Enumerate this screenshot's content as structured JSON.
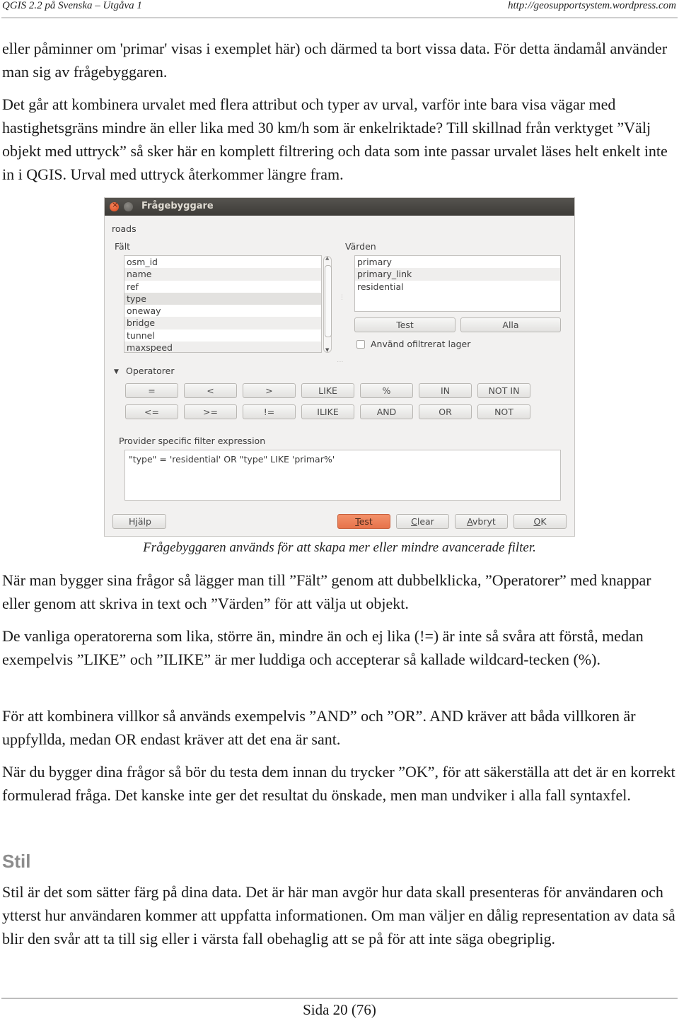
{
  "header": {
    "left": "QGIS 2.2 på Svenska – Utgåva 1",
    "right": "http://geosupportsystem.wordpress.com"
  },
  "paragraphs": {
    "p1": "eller påminner om 'primar' visas i exemplet här) och därmed ta bort vissa data. För detta ändamål använder man sig av frågebyggaren.",
    "p2": "Det går att kombinera urvalet med flera attribut och typer av urval, varför inte bara visa vägar med hastighetsgräns mindre än eller lika med 30 km/h som är enkelriktade? Till skillnad från verktyget ”Välj objekt med uttryck” så sker här en komplett filtrering och data som inte passar urvalet läses helt enkelt inte in i QGIS. Urval med uttryck återkommer längre fram.",
    "p3": "När man bygger sina frågor så lägger man till ”Fält” genom att dubbelklicka, ”Operatorer” med knappar eller genom att skriva in text och ”Värden” för att välja ut objekt.",
    "p4": "De vanliga operatorerna som lika, större än, mindre än och ej lika (!=) är inte så svåra att förstå, medan exempelvis ”LIKE” och ”ILIKE” är mer luddiga och accepterar så kallade wildcard-tecken (%).",
    "p5": "För att kombinera villkor så används exempelvis ”AND” och ”OR”. AND kräver att båda villkoren är uppfyllda, medan OR endast kräver att det ena är sant.",
    "p6": "När du bygger dina frågor så bör du testa dem innan du trycker ”OK”, för att säkerställa att det är en korrekt formulerad fråga. Det kanske inte ger det resultat du önskade, men man undviker i alla fall syntaxfel.",
    "p7": "Stil är det som sätter färg på dina data. Det är här man avgör hur data skall presenteras för användaren och ytterst hur användaren kommer att uppfatta informationen. Om man väljer en dålig representation av data så blir den svår att ta till sig eller i värsta fall obehaglig att se på för att inte säga obegriplig."
  },
  "heading_stil": "Stil",
  "caption": "Frågebyggaren används för att skapa mer eller mindre avancerade filter.",
  "footer": "Sida 20 (76)",
  "dialog": {
    "title": "Frågebyggare",
    "layer_name": "roads",
    "fields_label": "Fält",
    "fields": [
      "osm_id",
      "name",
      "ref",
      "type",
      "oneway",
      "bridge",
      "tunnel",
      "maxspeed"
    ],
    "selected_field": "type",
    "values_label": "Värden",
    "values": [
      "primary",
      "primary_link",
      "residential"
    ],
    "test_values_button": "Test",
    "all_values_button": "Alla",
    "unfiltered_checkbox_label": "Använd ofiltrerat lager",
    "unfiltered_checked": false,
    "operators_label": "Operatorer",
    "operators_row1": [
      "=",
      "<",
      ">",
      "LIKE",
      "%",
      "IN",
      "NOT IN"
    ],
    "operators_row2": [
      "<=",
      ">=",
      "!=",
      "ILIKE",
      "AND",
      "OR",
      "NOT"
    ],
    "expression_label": "Provider specific filter expression",
    "expression": "\"type\" = 'residential' OR \"type\"  LIKE 'primar%'",
    "buttons": {
      "help": "Hjälp",
      "test": "Test",
      "clear": "Clear",
      "cancel": "Avbryt",
      "ok": "OK"
    },
    "accent_color": "#e9784f"
  }
}
